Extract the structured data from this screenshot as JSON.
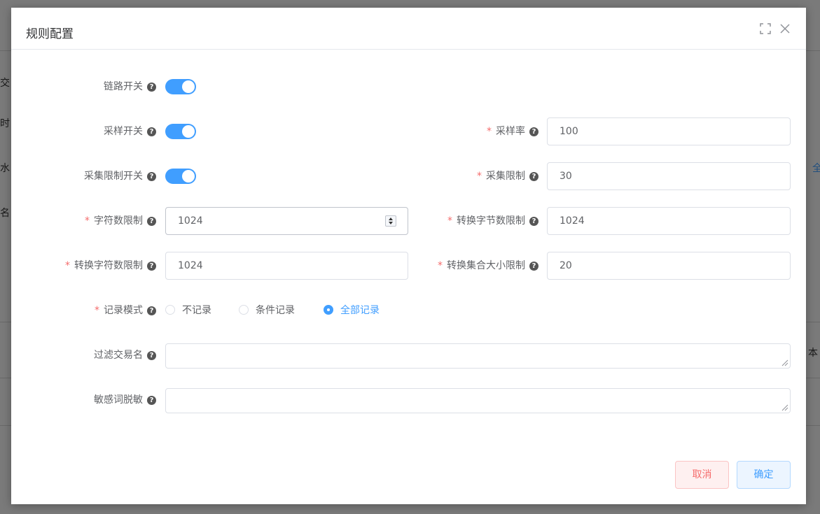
{
  "background": {
    "left_chars": [
      "交",
      "时",
      "水",
      "名"
    ],
    "right_chars": [
      "全",
      "本"
    ]
  },
  "dialog": {
    "title": "规则配置",
    "icons": {
      "fullscreen": "fullscreen-icon",
      "close": "close-icon"
    }
  },
  "form": {
    "link_switch": {
      "label": "链路开关",
      "on": true
    },
    "sample_switch": {
      "label": "采样开关",
      "on": true
    },
    "collect_limit_switch": {
      "label": "采集限制开关",
      "on": true
    },
    "sample_rate": {
      "label": "采样率",
      "value": "100",
      "required": true
    },
    "collect_limit": {
      "label": "采集限制",
      "value": "30",
      "required": true
    },
    "char_limit": {
      "label": "字符数限制",
      "value": "1024",
      "required": true
    },
    "convert_byte_limit": {
      "label": "转换字节数限制",
      "value": "1024",
      "required": true
    },
    "convert_char_limit": {
      "label": "转换字符数限制",
      "value": "1024",
      "required": true
    },
    "convert_collection_limit": {
      "label": "转换集合大小限制",
      "value": "20",
      "required": true
    },
    "record_mode": {
      "label": "记录模式",
      "required": true,
      "options": [
        "不记录",
        "条件记录",
        "全部记录"
      ],
      "selected": "全部记录"
    },
    "filter_tx_name": {
      "label": "过滤交易名",
      "value": ""
    },
    "sensitive_mask": {
      "label": "敏感词脱敏",
      "value": ""
    },
    "required_mark": "*",
    "help_glyph": "?"
  },
  "footer": {
    "cancel_label": "取消",
    "ok_label": "确定"
  },
  "colors": {
    "primary": "#409eff",
    "danger": "#f56c6c"
  }
}
